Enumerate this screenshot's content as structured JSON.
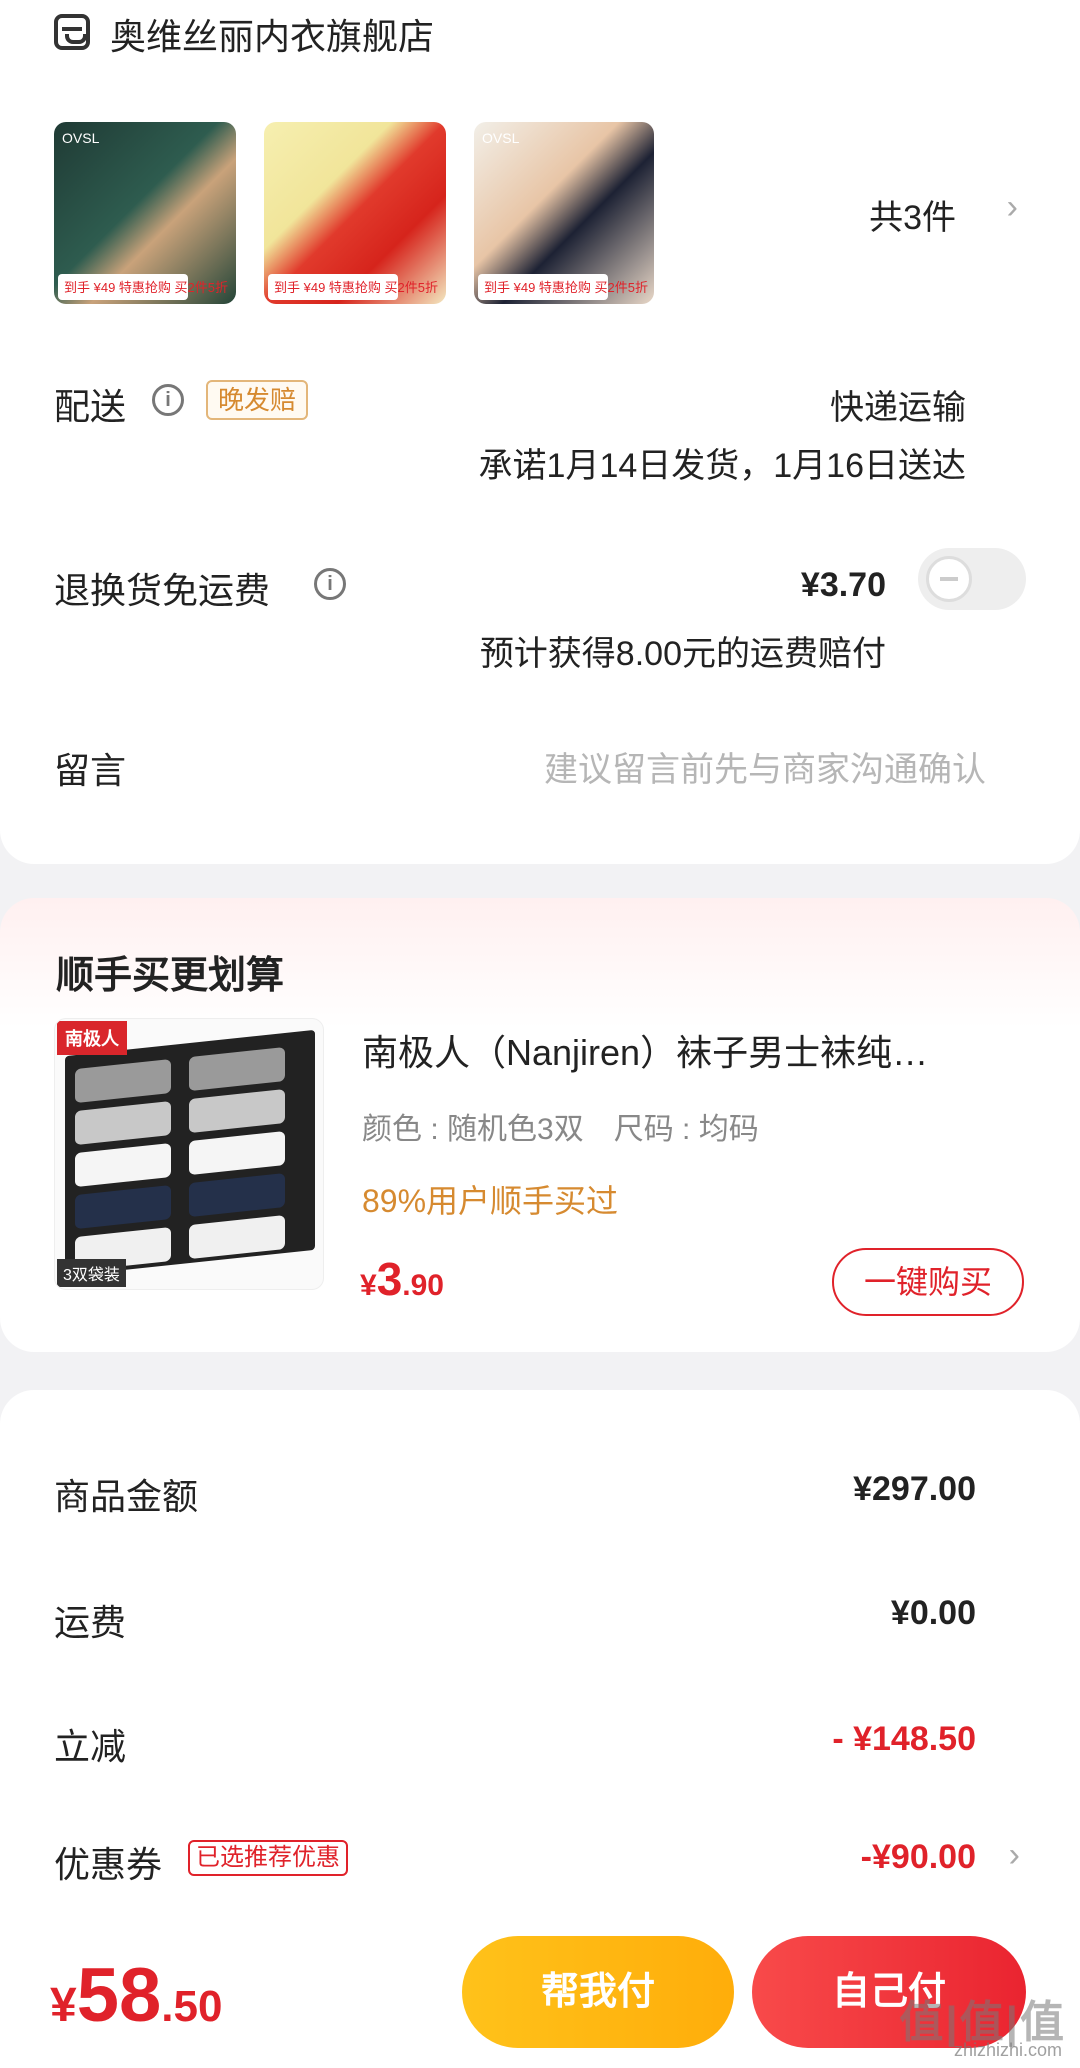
{
  "store": {
    "name": "奥维丝丽内衣旗舰店",
    "icon": "store-icon"
  },
  "items": {
    "thumbs": [
      {
        "brand": "OVSL",
        "tag": "到手 ¥49 特惠抢购 买2件5折"
      },
      {
        "brand": "",
        "tag": "到手 ¥49 特惠抢购 买2件5折"
      },
      {
        "brand": "OVSL",
        "tag": "到手 ¥49 特惠抢购 买2件5折"
      }
    ],
    "count": "共3件"
  },
  "delivery": {
    "label": "配送",
    "badge": "晚发赔",
    "method": "快递运输",
    "promise": "承诺1月14日发货，1月16日送达"
  },
  "return_shipping": {
    "label": "退换货免运费",
    "price": "¥3.70",
    "note": "预计获得8.00元的运费赔付"
  },
  "message": {
    "label": "留言",
    "placeholder": "建议留言前先与商家沟通确认"
  },
  "upsell": {
    "title": "顺手买更划算",
    "product_title": "南极人（Nanjiren）袜子男士袜纯…",
    "spec": "颜色 : 随机色3双　尺码 : 均码",
    "hint": "89%用户顺手买过",
    "price_currency": "¥",
    "price_int": "3",
    "price_dec": ".90",
    "button": "一键购买",
    "image_logo": "南极人",
    "image_pack": "3双袋装"
  },
  "totals": {
    "goods_label": "商品金额",
    "goods_value": "¥297.00",
    "shipping_label": "运费",
    "shipping_value": "¥0.00",
    "discount_label": "立减",
    "discount_value": "- ¥148.50",
    "coupon_label": "优惠券",
    "coupon_badge": "已选推荐优惠",
    "coupon_value": "-¥90.00"
  },
  "footer": {
    "currency": "¥",
    "total_int": "58",
    "total_dec": ".50",
    "help_pay": "帮我付",
    "self_pay": "自己付",
    "watermark": "值|值|值",
    "watermark_sub": "zhizhizhi.com"
  },
  "colors": {
    "accent_red": "#e0222a",
    "accent_orange": "#d68a30",
    "help_button": "#ffb811"
  }
}
